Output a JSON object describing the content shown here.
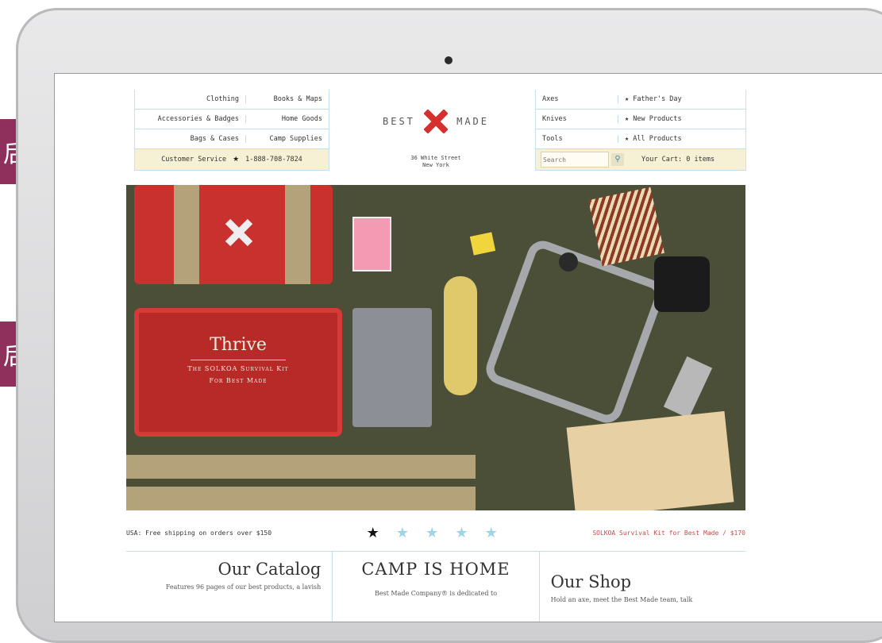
{
  "colors": {
    "side_tab": "#8e2f5c",
    "accent_red": "#d6302e",
    "star_blue": "#9fd3e8"
  },
  "side_tabs": [
    {
      "glyph": "后"
    },
    {
      "glyph": "后"
    }
  ],
  "nav": {
    "left": {
      "rows": [
        [
          "Clothing",
          "Books & Maps"
        ],
        [
          "Accessories & Badges",
          "Home Goods"
        ],
        [
          "Bags & Cases",
          "Camp Supplies"
        ]
      ],
      "service": "Customer Service",
      "phone": "1-888-708-7824"
    },
    "logo": {
      "left_word": "BEST",
      "right_word": "MADE",
      "icon": "x-mark-icon"
    },
    "address": {
      "line1": "36 White Street",
      "line2": "New York"
    },
    "right": {
      "rows": [
        [
          "Axes",
          "Father's Day"
        ],
        [
          "Knives",
          "New Products"
        ],
        [
          "Tools",
          "All Products"
        ]
      ],
      "search_placeholder": "Search",
      "cart": "Your Cart: 0 items"
    }
  },
  "hero": {
    "kit_title": "Thrive",
    "kit_line1": "The SOLKOA Survival Kit",
    "kit_line2": "For Best Made"
  },
  "strip": {
    "shipping": "USA: Free shipping on orders over $150",
    "promo": "SOLKOA Survival Kit for Best Made / $170"
  },
  "sections": [
    {
      "heading": "Our Catalog",
      "text": "Features 96 pages of our best products, a lavish"
    },
    {
      "heading": "CAMP IS HOME",
      "text": "Best Made Company® is dedicated to"
    },
    {
      "heading": "Our Shop",
      "text": "Hold an axe, meet the Best Made team, talk"
    }
  ]
}
